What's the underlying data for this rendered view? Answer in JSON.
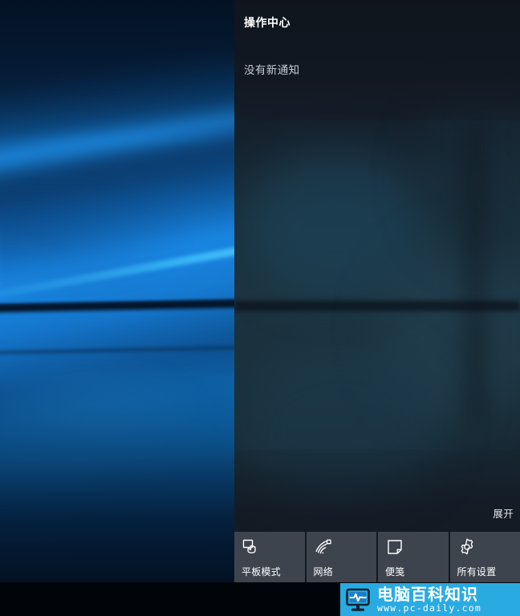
{
  "panel": {
    "title": "操作中心",
    "empty_notifications": "没有新通知",
    "expand_label": "展开",
    "background_color": "#111822",
    "tile_color": "#3e444d"
  },
  "quick_actions": [
    {
      "label": "平板模式",
      "icon": "tablet-mode-icon"
    },
    {
      "label": "网络",
      "icon": "network-wifi-icon"
    },
    {
      "label": "便笺",
      "icon": "sticky-note-icon"
    },
    {
      "label": "所有设置",
      "icon": "settings-gear-icon"
    }
  ],
  "taskbar": {
    "color": "#010409"
  },
  "watermark": {
    "brand_cn": "电脑百科知识",
    "url": "www.pc-daily.com",
    "accent_color": "#29abe2",
    "icon": "monitor-pulse-icon"
  },
  "desktop": {
    "wallpaper": "windows-10-hero-wallpaper"
  }
}
